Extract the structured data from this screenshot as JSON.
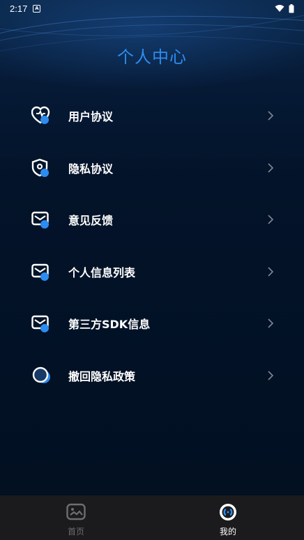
{
  "status_bar": {
    "time": "2:17",
    "notification_icon": "a-badge-icon",
    "wifi_icon": "wifi-icon",
    "battery_icon": "battery-icon"
  },
  "page": {
    "title": "个人中心",
    "title_color": "#2d8cf0"
  },
  "menu": {
    "items": [
      {
        "label": "用户协议",
        "icon": "heart-shield-icon"
      },
      {
        "label": "隐私协议",
        "icon": "shield-icon"
      },
      {
        "label": "意见反馈",
        "icon": "mail-icon"
      },
      {
        "label": "个人信息列表",
        "icon": "mail-icon"
      },
      {
        "label": "第三方SDK信息",
        "icon": "mail-icon"
      },
      {
        "label": "撤回隐私政策",
        "icon": "circle-icon"
      }
    ],
    "arrow_icon": "chevron-right-icon"
  },
  "tabbar": {
    "tabs": [
      {
        "label": "首页",
        "icon": "home-image-icon",
        "active": false
      },
      {
        "label": "我的",
        "icon": "profile-icon",
        "active": true
      }
    ],
    "active_color": "#ffffff",
    "inactive_color": "#6e6e72",
    "accent": "#2d8cf0"
  }
}
